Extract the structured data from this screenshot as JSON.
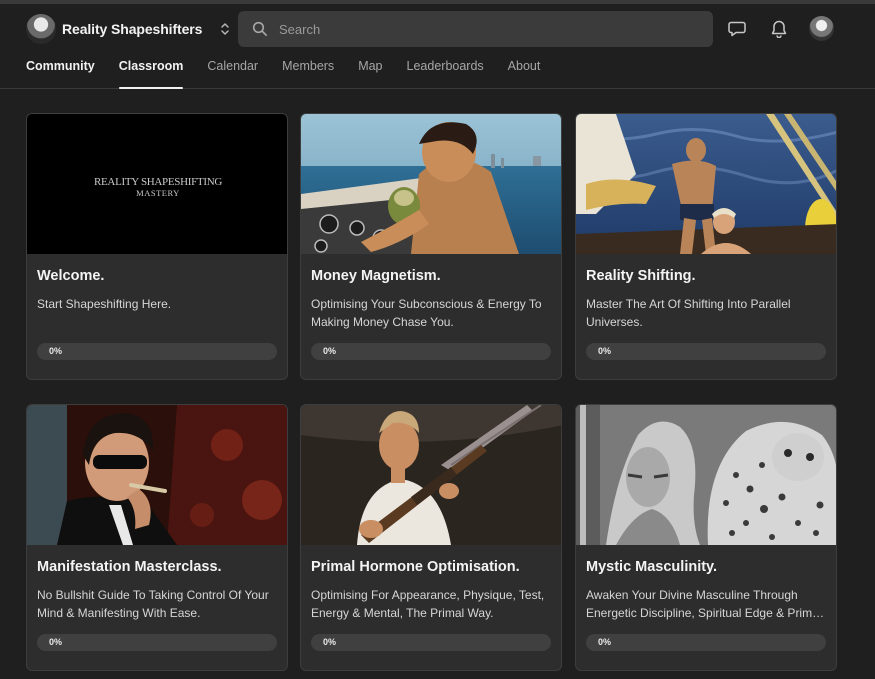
{
  "group": {
    "name": "Reality Shapeshifters"
  },
  "search": {
    "placeholder": "Search"
  },
  "nav": {
    "tabs": [
      {
        "label": "Community",
        "state": "bold"
      },
      {
        "label": "Classroom",
        "state": "active"
      },
      {
        "label": "Calendar",
        "state": "normal"
      },
      {
        "label": "Members",
        "state": "normal"
      },
      {
        "label": "Map",
        "state": "normal"
      },
      {
        "label": "Leaderboards",
        "state": "normal"
      },
      {
        "label": "About",
        "state": "normal"
      }
    ]
  },
  "icons": {
    "search": "search-icon",
    "switcher": "chevron-up-down-icon",
    "chat": "chat-icon",
    "notifications": "bell-icon"
  },
  "colors": {
    "background": "#1f1f1f",
    "card": "#2d2d2d",
    "search": "#3b3b3b",
    "progress_track": "#404040"
  },
  "courses": [
    {
      "title": "Welcome.",
      "description": "Start Shapeshifting Here.",
      "progress": 0,
      "progress_label": "0%",
      "thumbnail_text": [
        "REALITY SHAPESHIFTING",
        "MASTERY"
      ]
    },
    {
      "title": "Money Magnetism.",
      "description": "Optimising Your Subconscious & Energy To Making Money Chase You.",
      "progress": 0,
      "progress_label": "0%"
    },
    {
      "title": "Reality Shifting.",
      "description": "Master The Art Of Shifting Into Parallel Universes.",
      "progress": 0,
      "progress_label": "0%"
    },
    {
      "title": "Manifestation Masterclass.",
      "description": "No Bullshit Guide To Taking Control Of Your Mind & Manifesting With Ease.",
      "progress": 0,
      "progress_label": "0%"
    },
    {
      "title": "Primal Hormone Optimisation.",
      "description": "Optimising For Appearance, Physique, Test, Energy & Mental, The Primal Way.",
      "progress": 0,
      "progress_label": "0%"
    },
    {
      "title": "Mystic Masculinity.",
      "description": "Awaken Your Divine Masculine Through Energetic Discipline, Spiritual Edge & Primal Power.",
      "progress": 0,
      "progress_label": "0%"
    }
  ]
}
